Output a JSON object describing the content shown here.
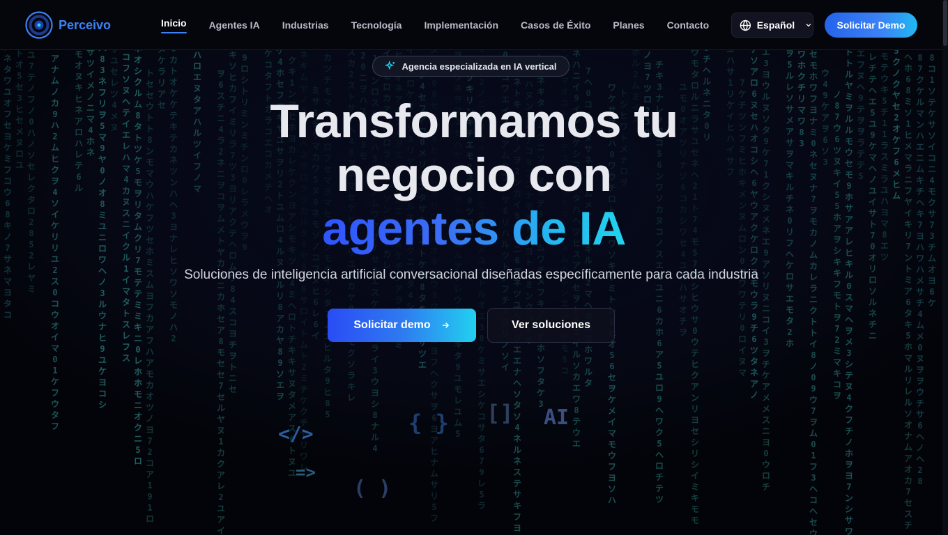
{
  "brand": {
    "name": "Perceivo"
  },
  "nav": {
    "items": [
      {
        "label": "Inicio",
        "active": true
      },
      {
        "label": "Agentes IA"
      },
      {
        "label": "Industrias"
      },
      {
        "label": "Tecnología"
      },
      {
        "label": "Implementación"
      },
      {
        "label": "Casos de Éxito"
      },
      {
        "label": "Planes"
      },
      {
        "label": "Contacto"
      }
    ]
  },
  "header": {
    "language_label": "Español",
    "demo_button": "Solicitar Demo"
  },
  "hero": {
    "badge": "Agencia especializada en IA vertical",
    "title_line1": "Transformamos tu",
    "title_line2": "negocio con",
    "title_highlight": "agentes de IA",
    "subtitle": "Soluciones de inteligencia artificial conversacional diseñadas específicamente para cada industria",
    "primary_cta": "Solicitar demo",
    "secondary_cta": "Ver soluciones"
  },
  "decor": {
    "code_symbols": [
      "</>",
      "{ }",
      "[]",
      "AI",
      "=>",
      "( )"
    ]
  },
  "colors": {
    "accent": "#3b82f6",
    "cyan": "#22d3ee",
    "background": "#050711",
    "matrix": "#1c5a56"
  }
}
